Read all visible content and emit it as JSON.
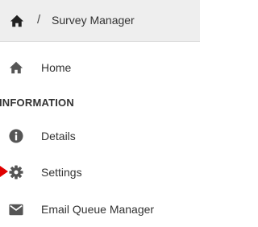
{
  "breadcrumb": {
    "home_icon": "home-icon",
    "separator": "/",
    "title": "Survey Manager"
  },
  "nav": {
    "home": {
      "label": "Home",
      "icon": "home-icon"
    },
    "section_heading": "INFORMATION",
    "items": [
      {
        "label": "Details",
        "icon": "info-circle-icon"
      },
      {
        "label": "Settings",
        "icon": "gear-icon"
      },
      {
        "label": "Email Queue Manager",
        "icon": "envelope-icon"
      }
    ]
  },
  "colors": {
    "breadcrumb_bg": "#eeeeee",
    "icon": "#555555",
    "text": "#333333",
    "pointer_arrow": "#e00000"
  }
}
